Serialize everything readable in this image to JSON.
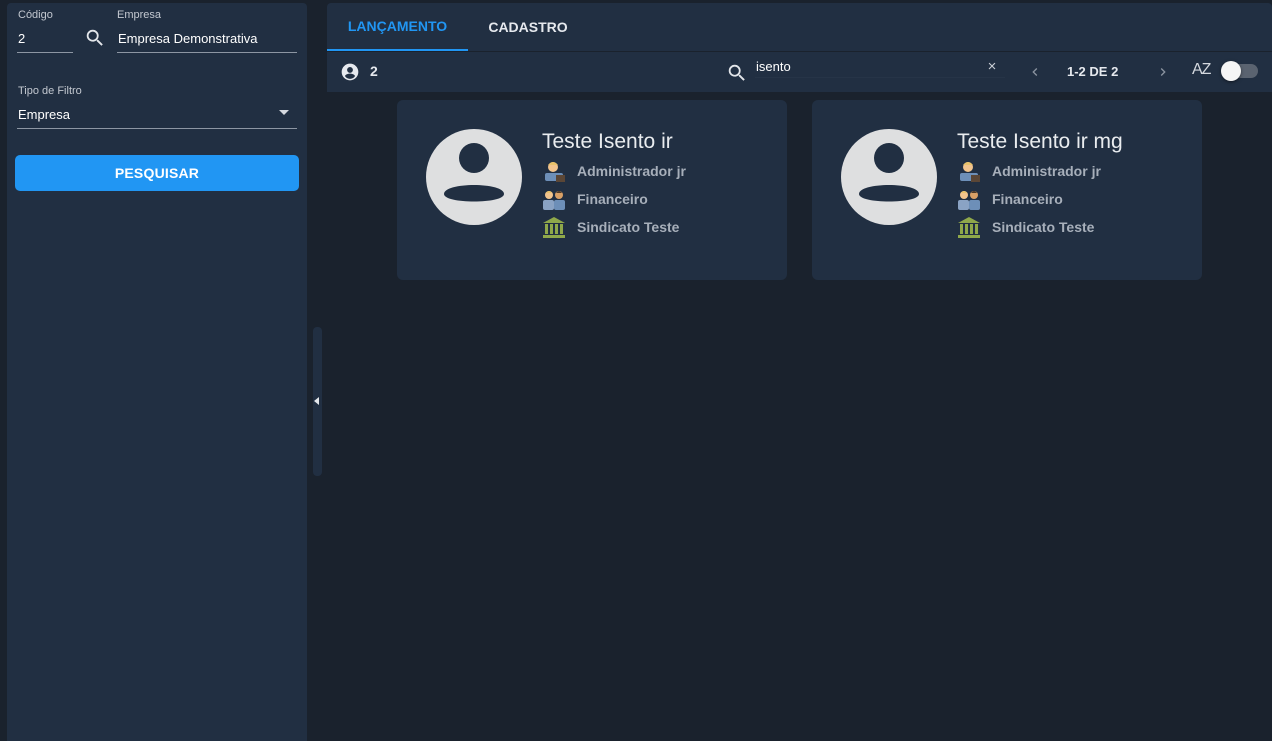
{
  "sidebar": {
    "codigo_label": "Código",
    "codigo_value": "2",
    "empresa_label": "Empresa",
    "empresa_value": "Empresa Demonstrativa",
    "filtro_label": "Tipo de Filtro",
    "filtro_value": "Empresa",
    "search_button": "PESQUISAR"
  },
  "tabs": [
    {
      "label": "LANÇAMENTO",
      "active": true
    },
    {
      "label": "CADASTRO",
      "active": false
    }
  ],
  "toolbar": {
    "count": "2",
    "search_value": "isento",
    "clear_symbol": "×",
    "pagination": "1-2 DE 2",
    "sort_label": "AZ"
  },
  "cards": [
    {
      "name": "Teste Isento ir",
      "cargo": "Administrador jr",
      "departamento": "Financeiro",
      "sindicato": "Sindicato Teste"
    },
    {
      "name": "Teste Isento ir mg",
      "cargo": "Administrador jr",
      "departamento": "Financeiro",
      "sindicato": "Sindicato Teste"
    }
  ],
  "colors": {
    "accent": "#2196f3",
    "panel": "#212f42",
    "background": "#1a222d"
  },
  "icons": [
    "search-icon",
    "chevron-down-icon",
    "account-circle-icon",
    "close-icon",
    "chevron-left-icon",
    "chevron-right-icon",
    "sort-az-icon",
    "avatar-placeholder-icon",
    "office-worker-icon",
    "people-group-icon",
    "bank-building-icon"
  ]
}
